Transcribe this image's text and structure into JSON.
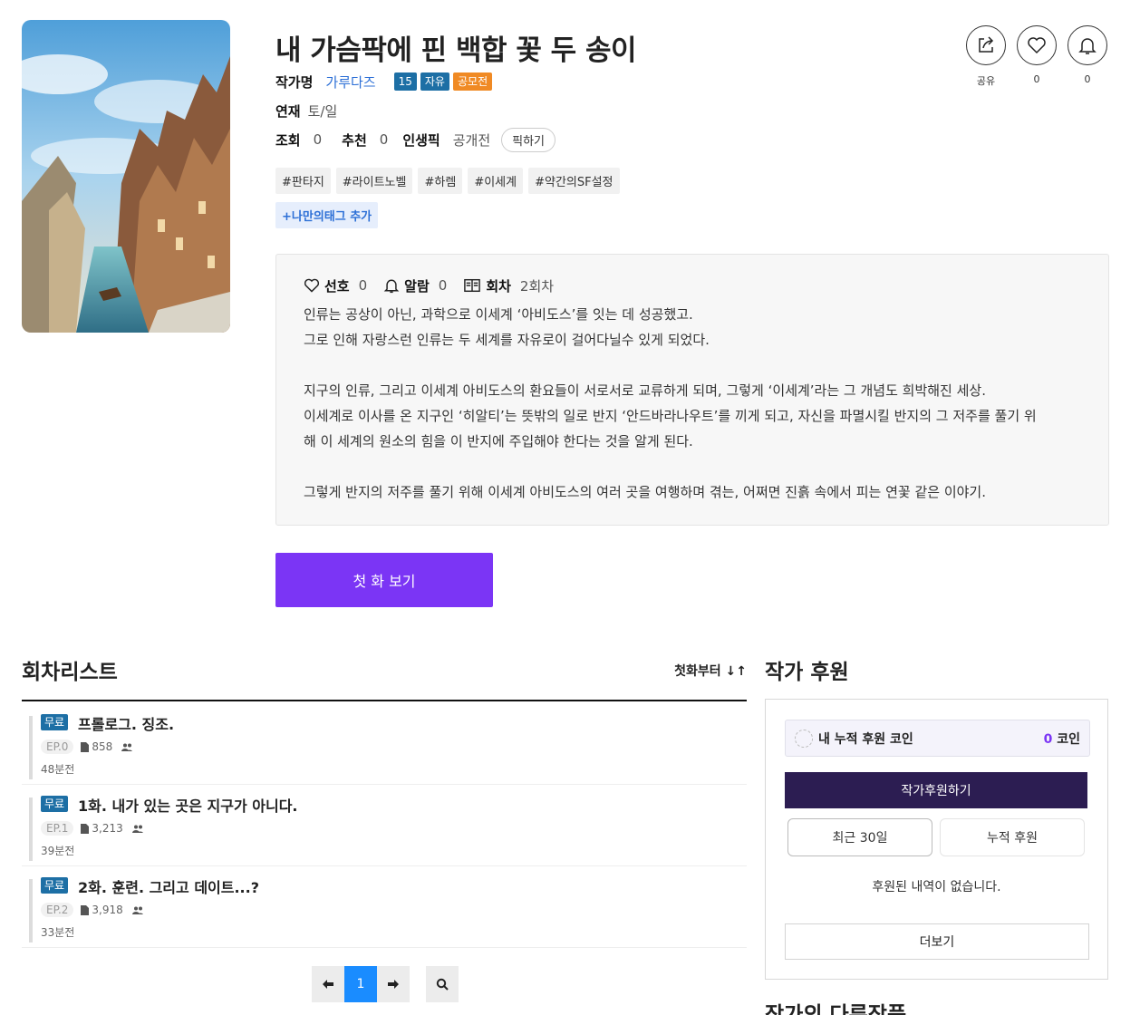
{
  "novel": {
    "title": "내 가슴팍에 핀 백합 꽃 두 송이",
    "author_label": "작가명",
    "author_name": "가루다즈",
    "badges": [
      "15",
      "자유",
      "공모전"
    ],
    "serial_label": "연재",
    "serial_value": "토/일",
    "views_label": "조회",
    "views_value": "0",
    "recommend_label": "추천",
    "recommend_value": "0",
    "lifepick_label": "인생픽",
    "lifepick_value": "공개전",
    "pick_button": "픽하기",
    "tags": [
      "#판타지",
      "#라이트노벨",
      "#하렘",
      "#이세계",
      "#약간의SF설정"
    ],
    "my_tag_button": "+나만의태그 추가"
  },
  "actions": {
    "share_label": "공유",
    "like_count": "0",
    "alarm_count": "0"
  },
  "synopsis": {
    "fav_label": "선호",
    "fav_value": "0",
    "alarm_label": "알람",
    "alarm_value": "0",
    "episode_label": "회차",
    "episode_value": "2회차",
    "lines": [
      "인류는 공상이 아닌, 과학으로 이세계 ‘아비도스’를 잇는 데 성공했고.",
      "그로 인해 자랑스런 인류는 두 세계를 자유로이 걸어다닐수 있게 되었다.",
      "",
      "지구의 인류, 그리고 이세계 아비도스의 환요들이 서로서로 교류하게 되며, 그렇게 ‘이세계’라는 그 개념도 희박해진 세상.",
      "이세계로 이사를 온 지구인 ‘히알티’는 뜻밖의 일로 반지 ‘안드바라나우트’를 끼게 되고, 자신을 파멸시킬 반지의 그 저주를 풀기 위",
      "해 이 세계의 원소의 힘을 이 반지에 주입해야 한다는 것을 알게 된다.",
      "",
      "그렇게 반지의 저주를 풀기 위해 이세계 아비도스의 여러 곳을 여행하며 겪는, 어쩌면 진흙 속에서 피는 연꽃 같은 이야기."
    ]
  },
  "first_episode_button": "첫 화 보기",
  "episode_list": {
    "title": "회차리스트",
    "sort_label": "첫화부터 ↓↑",
    "episodes": [
      {
        "badge": "무료",
        "title": "프롤로그. 징조.",
        "ep": "EP.0",
        "views": "858",
        "time": "48분전"
      },
      {
        "badge": "무료",
        "title": "1화. 내가 있는 곳은 지구가 아니다.",
        "ep": "EP.1",
        "views": "3,213",
        "time": "39분전"
      },
      {
        "badge": "무료",
        "title": "2화. 훈련. 그리고 데이트...?",
        "ep": "EP.2",
        "views": "3,918",
        "time": "33분전"
      }
    ],
    "pagination": {
      "current": "1"
    }
  },
  "support": {
    "title": "작가 후원",
    "coin_label": "내 누적 후원 코인",
    "coin_value": "0",
    "coin_unit": "코인",
    "support_button": "작가후원하기",
    "tab_recent": "최근 30일",
    "tab_total": "누적 후원",
    "empty_text": "후원된 내역이 없습니다.",
    "more_button": "더보기"
  },
  "other_works_title": "작가의 다른작품",
  "colors": {
    "accent": "#7b35f5",
    "link": "#2c6fd6",
    "badge_blue": "#1d6fa5",
    "badge_orange": "#f08a24",
    "support_btn": "#2c1d52",
    "page_active": "#1a8cff"
  }
}
